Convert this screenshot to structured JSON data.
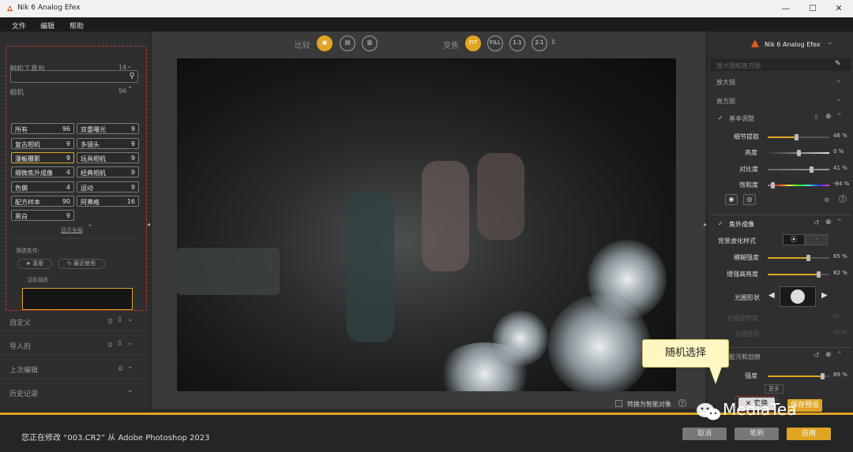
{
  "window": {
    "title": "Nik 6 Analog Efex"
  },
  "menu": [
    "文件",
    "编辑",
    "帮助"
  ],
  "left": {
    "toolkit": {
      "label": "相机工具包",
      "count": "14"
    },
    "camera": {
      "label": "相机",
      "count": "96"
    },
    "categories": [
      {
        "label": "所有",
        "count": "96"
      },
      {
        "label": "双重曝光",
        "count": "9"
      },
      {
        "label": "复古相机",
        "count": "9"
      },
      {
        "label": "多镜头",
        "count": "9"
      },
      {
        "label": "湿板摄影",
        "count": "9"
      },
      {
        "label": "玩具相机",
        "count": "9"
      },
      {
        "label": "细微焦外成像",
        "count": "4"
      },
      {
        "label": "经典相机",
        "count": "9"
      },
      {
        "label": "色偏",
        "count": "4"
      },
      {
        "label": "运动",
        "count": "9"
      },
      {
        "label": "配方样本",
        "count": "90"
      },
      {
        "label": "阿弗格",
        "count": "16"
      },
      {
        "label": "黑白",
        "count": "9"
      }
    ],
    "show_all": "显示全部",
    "filter_label": "筛选条件:",
    "filters": [
      "喜爱",
      "最近使用"
    ],
    "preset_caption": "湿板摄影",
    "sections": [
      {
        "label": "自定义",
        "count": "0"
      },
      {
        "label": "导入的",
        "count": "0"
      },
      {
        "label": "上次编辑",
        "count": "0"
      },
      {
        "label": "历史记录",
        "count": ""
      }
    ]
  },
  "center": {
    "compare_label": "比较",
    "zoom_label": "变焦",
    "zoom_buttons": [
      "FIT",
      "FILL",
      "1:1",
      "2:1"
    ],
    "smart_object": "转换为智能对象"
  },
  "right": {
    "brand": "Nik 6 Analog Efex",
    "favorites_placeholder": "放大镜和直方图",
    "loupe": "放大镜",
    "histogram": "直方图",
    "basic": {
      "label": "基本调整",
      "rows": [
        {
          "label": "细节提取",
          "value": "46 %",
          "pct": 0.46
        },
        {
          "label": "亮度",
          "value": "0 %",
          "pct": 0.5
        },
        {
          "label": "对比度",
          "value": "41 %",
          "pct": 0.7
        },
        {
          "label": "饱和度",
          "value": "-84 %",
          "pct": 0.08
        }
      ]
    },
    "bokeh": {
      "label": "焦外成像",
      "style_label": "背景虚化样式",
      "rows": [
        {
          "label": "模糊强度",
          "value": "65 %",
          "pct": 0.65
        },
        {
          "label": "增强高亮度",
          "value": "82 %",
          "pct": 0.82
        }
      ],
      "shape_label": "光圈形状",
      "rotation_label": "光圈旋转度",
      "rotation_value": "0°",
      "position_label": "光圈变形",
      "position_value": "50 %"
    },
    "dirt": {
      "label": "脏污和划痕",
      "strength_label": "强度",
      "strength_value": "89 %",
      "strength_pct": 0.89,
      "more": "更多"
    }
  },
  "callout": "随机选择",
  "random_button": "变换",
  "save_preset": "保存预设",
  "status": "您正在修改 “003.CR2” 从 Adobe Photoshop 2023",
  "footer": {
    "cancel": "取消",
    "brush": "笔刷",
    "apply": "应用"
  },
  "watermark": "MediaTea",
  "colors": {
    "accent": "#e0a523",
    "highlight": "#c8342c"
  }
}
